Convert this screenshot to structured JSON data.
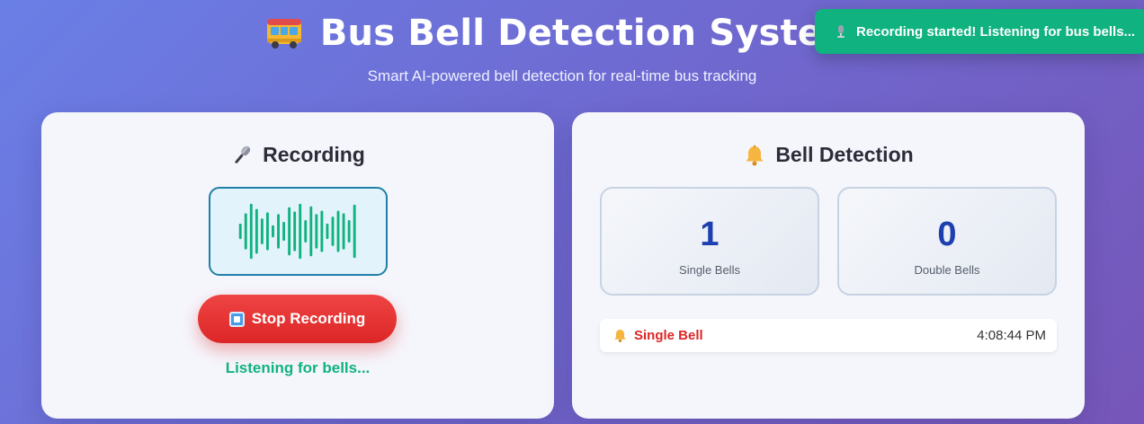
{
  "header": {
    "title": "Bus Bell Detection System",
    "subtitle": "Smart AI-powered bell detection for real-time bus tracking",
    "icon": "bus-icon"
  },
  "toast": {
    "text": "Recording started! Listening for bus bells...",
    "icon": "microphone-icon",
    "color": "#10b27f"
  },
  "recording": {
    "title": "Recording",
    "icon": "microphone-icon",
    "stop_label": "Stop Recording",
    "stop_icon": "stop-square-icon",
    "status": "Listening for bells...",
    "status_color": "#10b27f",
    "button_color": "#dc2626"
  },
  "detection": {
    "title": "Bell Detection",
    "icon": "bell-icon",
    "stats": [
      {
        "value": "1",
        "label": "Single Bells"
      },
      {
        "value": "0",
        "label": "Double Bells"
      }
    ],
    "log": [
      {
        "type": "Single Bell",
        "time": "4:08:44 PM",
        "icon": "bell-icon"
      }
    ],
    "value_color": "#1e40af"
  }
}
